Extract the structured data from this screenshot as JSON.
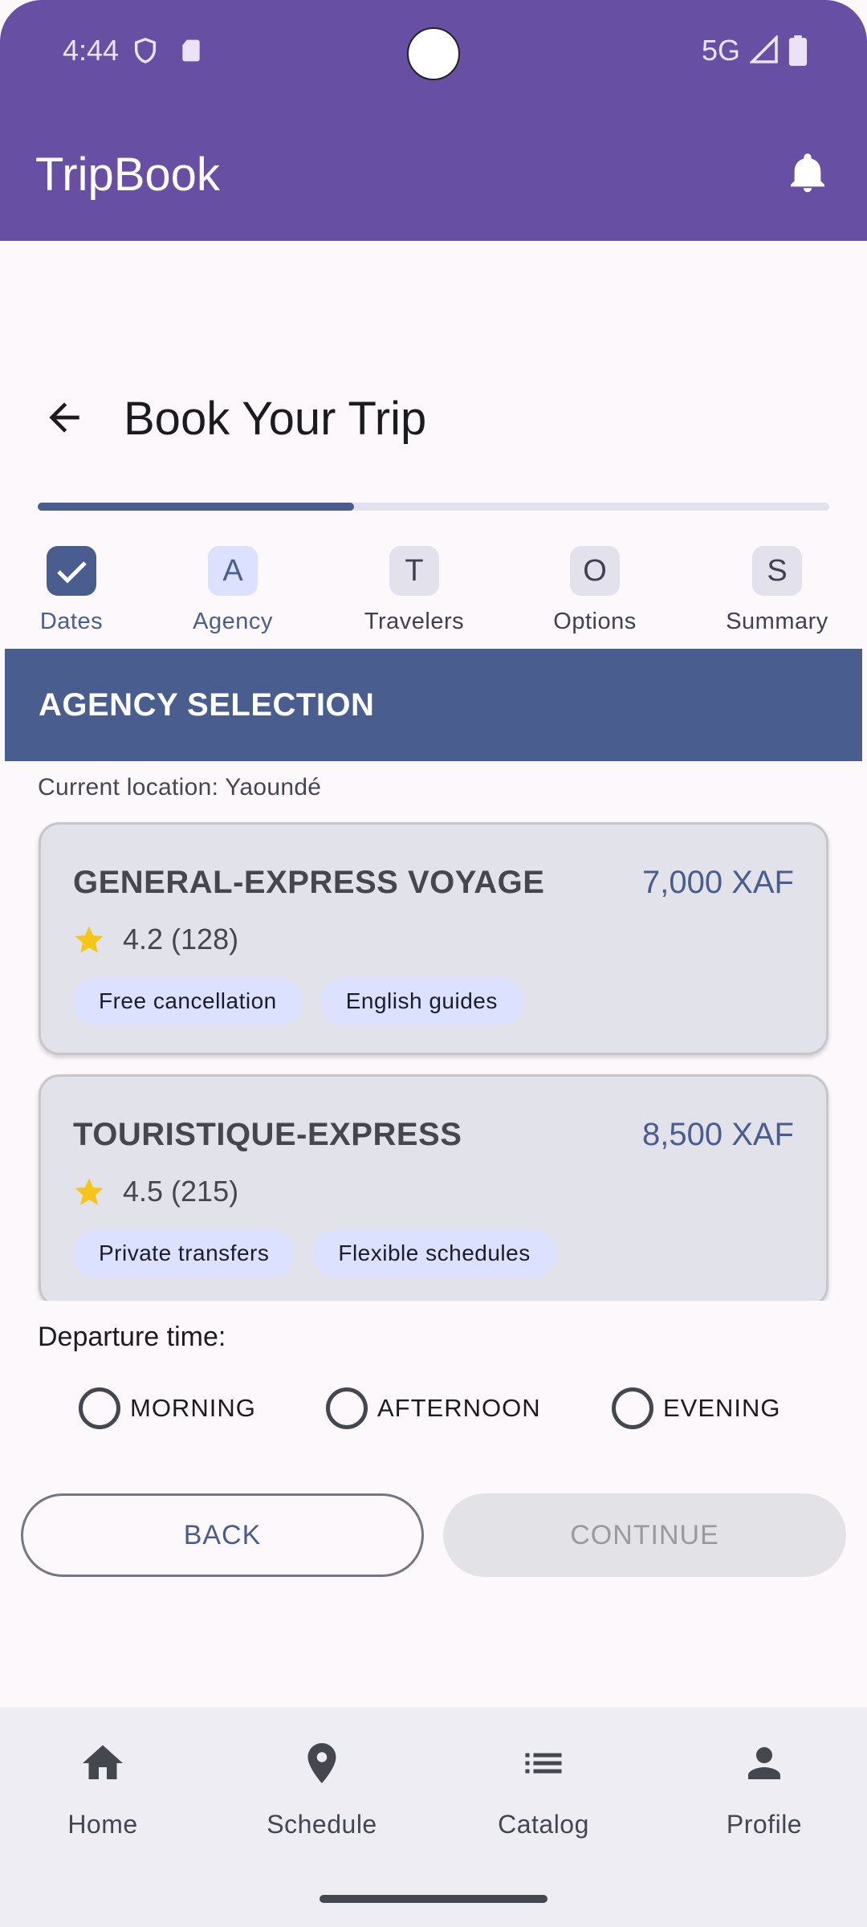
{
  "status_bar": {
    "time": "4:44",
    "network": "5G"
  },
  "app_bar": {
    "title": "TripBook"
  },
  "page": {
    "title": "Book Your Trip",
    "progress_fraction": 0.4
  },
  "steps": [
    {
      "letter": "",
      "label": "Dates",
      "state": "done"
    },
    {
      "letter": "A",
      "label": "Agency",
      "state": "active"
    },
    {
      "letter": "T",
      "label": "Travelers",
      "state": "pending"
    },
    {
      "letter": "O",
      "label": "Options",
      "state": "pending"
    },
    {
      "letter": "S",
      "label": "Summary",
      "state": "pending"
    }
  ],
  "section": {
    "title": "AGENCY SELECTION",
    "location": "Current location: Yaoundé"
  },
  "agencies": [
    {
      "name": "GENERAL-EXPRESS VOYAGE",
      "price": "7,000 XAF",
      "rating": "4.2 (128)",
      "tags": [
        "Free cancellation",
        "English guides"
      ]
    },
    {
      "name": "TOURISTIQUE-EXPRESS",
      "price": "8,500 XAF",
      "rating": "4.5 (215)",
      "tags": [
        "Private transfers",
        "Flexible schedules"
      ]
    }
  ],
  "departure": {
    "label": "Departure time:",
    "options": [
      "MORNING",
      "AFTERNOON",
      "EVENING"
    ]
  },
  "buttons": {
    "back": "BACK",
    "continue": "CONTINUE"
  },
  "bottom_nav": [
    {
      "label": "Home",
      "icon": "home-icon"
    },
    {
      "label": "Schedule",
      "icon": "location-pin-icon"
    },
    {
      "label": "Catalog",
      "icon": "list-icon"
    },
    {
      "label": "Profile",
      "icon": "person-icon"
    }
  ],
  "colors": {
    "primary": "#6750a4",
    "accent": "#4a5d8f",
    "chip": "#dbe1ff",
    "star": "#f5c518"
  }
}
